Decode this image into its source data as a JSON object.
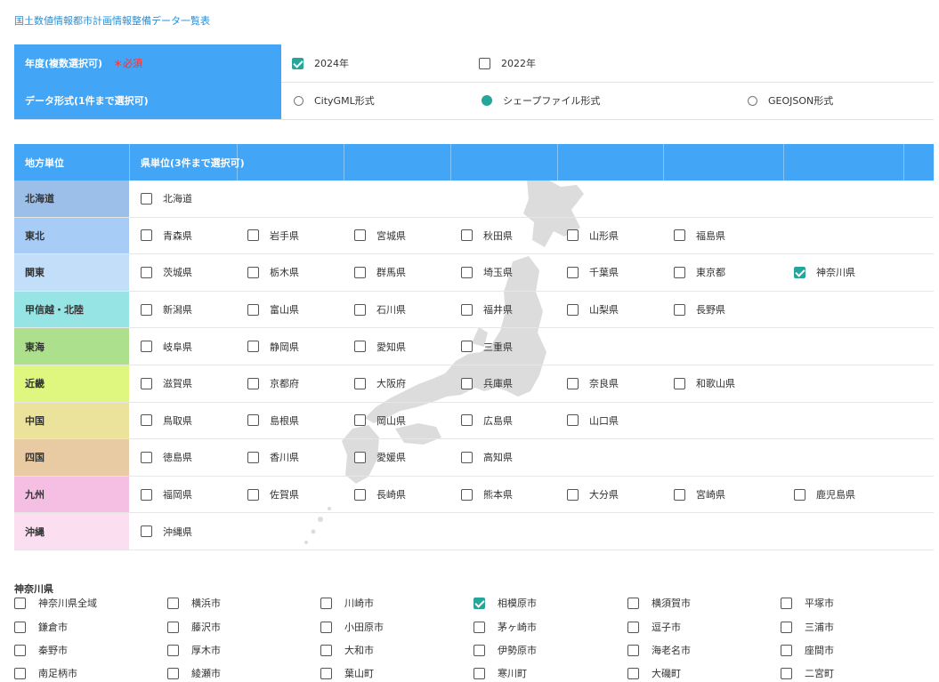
{
  "page_title": "国土数値情報都市計画情報整備データ一覧表",
  "form": {
    "year_label": "年度(複数選択可)",
    "required_mark": "＊必須",
    "years": [
      {
        "label": "2024年",
        "checked": true
      },
      {
        "label": "2022年",
        "checked": false
      }
    ],
    "format_label": "データ形式(1件まで選択可)",
    "formats": [
      {
        "label": "CityGML形式",
        "checked": false
      },
      {
        "label": "シェープファイル形式",
        "checked": true
      },
      {
        "label": "GEOJSON形式",
        "checked": false
      }
    ]
  },
  "table": {
    "header_region": "地方単位",
    "header_prefecture": "県単位(3件まで選択可)",
    "rows": [
      {
        "region": "北海道",
        "color": "#9cbfea",
        "prefs": [
          {
            "name": "北海道",
            "checked": false
          }
        ]
      },
      {
        "region": "東北",
        "color": "#a7cdf7",
        "prefs": [
          {
            "name": "青森県",
            "checked": false
          },
          {
            "name": "岩手県",
            "checked": false
          },
          {
            "name": "宮城県",
            "checked": false
          },
          {
            "name": "秋田県",
            "checked": false
          },
          {
            "name": "山形県",
            "checked": false
          },
          {
            "name": "福島県",
            "checked": false
          }
        ]
      },
      {
        "region": "関東",
        "color": "#c3def8",
        "prefs": [
          {
            "name": "茨城県",
            "checked": false
          },
          {
            "name": "栃木県",
            "checked": false
          },
          {
            "name": "群馬県",
            "checked": false
          },
          {
            "name": "埼玉県",
            "checked": false
          },
          {
            "name": "千葉県",
            "checked": false
          },
          {
            "name": "東京都",
            "checked": false
          },
          {
            "name": "神奈川県",
            "checked": true
          }
        ]
      },
      {
        "region": "甲信越・北陸",
        "color": "#97e4e4",
        "prefs": [
          {
            "name": "新潟県",
            "checked": false
          },
          {
            "name": "富山県",
            "checked": false
          },
          {
            "name": "石川県",
            "checked": false
          },
          {
            "name": "福井県",
            "checked": false
          },
          {
            "name": "山梨県",
            "checked": false
          },
          {
            "name": "長野県",
            "checked": false
          }
        ]
      },
      {
        "region": "東海",
        "color": "#ade08c",
        "prefs": [
          {
            "name": "岐阜県",
            "checked": false
          },
          {
            "name": "静岡県",
            "checked": false
          },
          {
            "name": "愛知県",
            "checked": false
          },
          {
            "name": "三重県",
            "checked": false
          }
        ]
      },
      {
        "region": "近畿",
        "color": "#dff67f",
        "prefs": [
          {
            "name": "滋賀県",
            "checked": false
          },
          {
            "name": "京都府",
            "checked": false
          },
          {
            "name": "大阪府",
            "checked": false
          },
          {
            "name": "兵庫県",
            "checked": false
          },
          {
            "name": "奈良県",
            "checked": false
          },
          {
            "name": "和歌山県",
            "checked": false
          }
        ]
      },
      {
        "region": "中国",
        "color": "#ebe39b",
        "prefs": [
          {
            "name": "鳥取県",
            "checked": false
          },
          {
            "name": "島根県",
            "checked": false
          },
          {
            "name": "岡山県",
            "checked": false
          },
          {
            "name": "広島県",
            "checked": false
          },
          {
            "name": "山口県",
            "checked": false
          }
        ]
      },
      {
        "region": "四国",
        "color": "#e8cba2",
        "prefs": [
          {
            "name": "徳島県",
            "checked": false
          },
          {
            "name": "香川県",
            "checked": false
          },
          {
            "name": "愛媛県",
            "checked": false
          },
          {
            "name": "高知県",
            "checked": false
          }
        ]
      },
      {
        "region": "九州",
        "color": "#f4bfe3",
        "prefs": [
          {
            "name": "福岡県",
            "checked": false
          },
          {
            "name": "佐賀県",
            "checked": false
          },
          {
            "name": "長崎県",
            "checked": false
          },
          {
            "name": "熊本県",
            "checked": false
          },
          {
            "name": "大分県",
            "checked": false
          },
          {
            "name": "宮崎県",
            "checked": false
          },
          {
            "name": "鹿児島県",
            "checked": false
          }
        ]
      },
      {
        "region": "沖縄",
        "color": "#fbdff1",
        "prefs": [
          {
            "name": "沖縄県",
            "checked": false
          }
        ]
      }
    ]
  },
  "cities": {
    "title": "神奈川県",
    "items": [
      {
        "name": "神奈川県全域",
        "checked": false
      },
      {
        "name": "横浜市",
        "checked": false
      },
      {
        "name": "川崎市",
        "checked": false
      },
      {
        "name": "相模原市",
        "checked": true
      },
      {
        "name": "横須賀市",
        "checked": false
      },
      {
        "name": "平塚市",
        "checked": false
      },
      {
        "name": "鎌倉市",
        "checked": false
      },
      {
        "name": "藤沢市",
        "checked": false
      },
      {
        "name": "小田原市",
        "checked": false
      },
      {
        "name": "茅ヶ崎市",
        "checked": false
      },
      {
        "name": "逗子市",
        "checked": false
      },
      {
        "name": "三浦市",
        "checked": false
      },
      {
        "name": "秦野市",
        "checked": false
      },
      {
        "name": "厚木市",
        "checked": false
      },
      {
        "name": "大和市",
        "checked": false
      },
      {
        "name": "伊勢原市",
        "checked": false
      },
      {
        "name": "海老名市",
        "checked": false
      },
      {
        "name": "座間市",
        "checked": false
      },
      {
        "name": "南足柄市",
        "checked": false
      },
      {
        "name": "綾瀬市",
        "checked": false
      },
      {
        "name": "葉山町",
        "checked": false
      },
      {
        "name": "寒川町",
        "checked": false
      },
      {
        "name": "大磯町",
        "checked": false
      },
      {
        "name": "二宮町",
        "checked": false
      }
    ]
  }
}
